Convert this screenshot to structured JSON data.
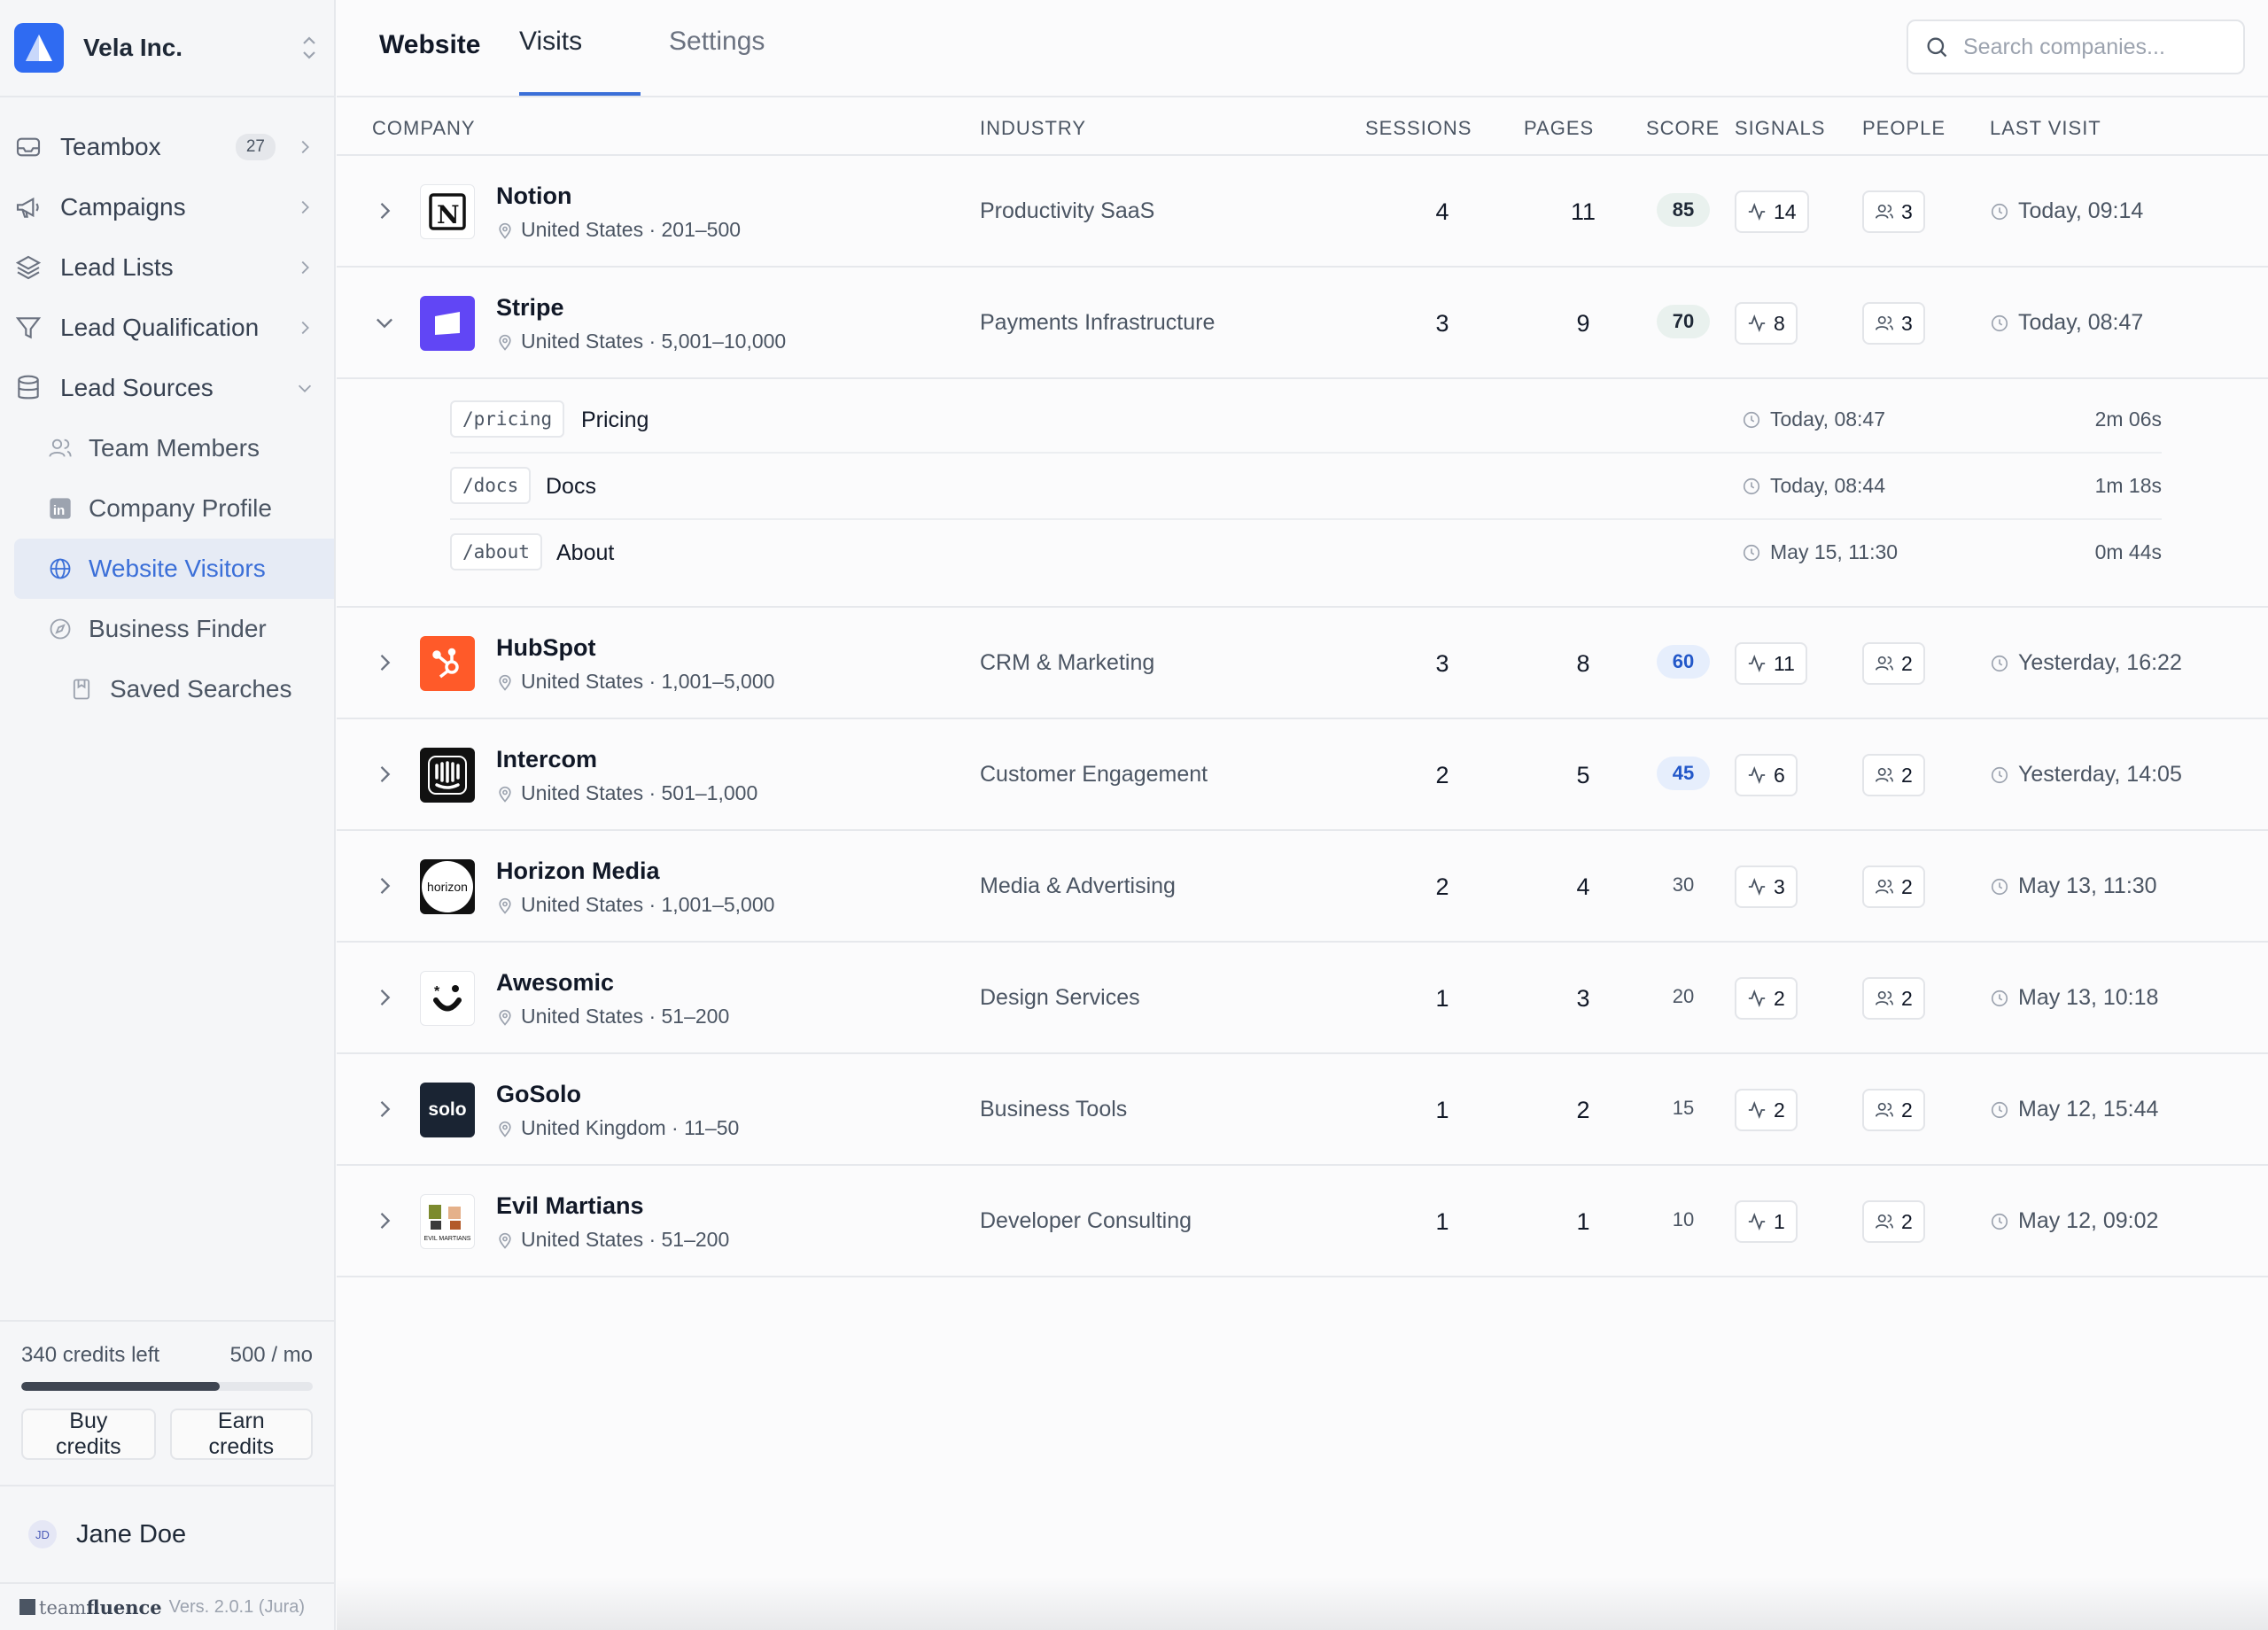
{
  "workspace": {
    "name": "Vela Inc."
  },
  "sidebar": {
    "items": [
      {
        "label": "Teambox",
        "badge": "27",
        "icon": "inbox-icon"
      },
      {
        "label": "Campaigns",
        "icon": "megaphone-icon"
      },
      {
        "label": "Lead Lists",
        "icon": "layers-icon"
      },
      {
        "label": "Lead Qualification",
        "icon": "filter-icon"
      },
      {
        "label": "Lead Sources",
        "icon": "database-icon"
      }
    ],
    "sub_items": [
      {
        "label": "Team Members",
        "icon": "users-icon"
      },
      {
        "label": "Company Profile",
        "icon": "linkedin-icon"
      },
      {
        "label": "Website Visitors",
        "icon": "globe-icon",
        "active": true
      },
      {
        "label": "Business Finder",
        "icon": "compass-icon"
      },
      {
        "label": "Saved Searches",
        "icon": "bookmark-icon"
      }
    ]
  },
  "credits": {
    "left_label": "340 credits left",
    "plan_label": "500 / mo",
    "used_fraction": 0.68,
    "buy_label": "Buy credits",
    "earn_label": "Earn credits"
  },
  "user": {
    "initials": "JD",
    "name": "Jane Doe"
  },
  "footer": {
    "brand_light": "team",
    "brand_bold": "fluence",
    "version": "Vers. 2.0.1 (Jura)"
  },
  "tabs": {
    "website": "Website",
    "visits": "Visits",
    "settings": "Settings",
    "active": "Visits"
  },
  "search": {
    "placeholder": "Search companies..."
  },
  "columns": {
    "company": "COMPANY",
    "industry": "INDUSTRY",
    "sessions": "SESSIONS",
    "pages": "PAGES",
    "score": "SCORE",
    "signals": "SIGNALS",
    "people": "PEOPLE",
    "last_visit": "LAST VISIT"
  },
  "companies": [
    {
      "name": "Notion",
      "meta": "United States · 201–500",
      "industry": "Productivity SaaS",
      "sessions": "4",
      "pages": "11",
      "score": "85",
      "signals": "14",
      "people": "3",
      "last_visit": "Today, 09:14"
    },
    {
      "name": "Stripe",
      "meta": "United States · 5,001–10,000",
      "industry": "Payments Infrastructure",
      "sessions": "3",
      "pages": "9",
      "score": "70",
      "signals": "8",
      "people": "3",
      "last_visit": "Today, 08:47",
      "visits": [
        {
          "path": "/pricing",
          "title": "Pricing",
          "time": "Today, 08:47",
          "duration": "2m 06s"
        },
        {
          "path": "/docs",
          "title": "Docs",
          "time": "Today, 08:44",
          "duration": "1m 18s"
        },
        {
          "path": "/about",
          "title": "About",
          "time": "May 15, 11:30",
          "duration": "0m 44s"
        }
      ]
    },
    {
      "name": "HubSpot",
      "meta": "United States · 1,001–5,000",
      "industry": "CRM & Marketing",
      "sessions": "3",
      "pages": "8",
      "score": "60",
      "signals": "11",
      "people": "2",
      "last_visit": "Yesterday, 16:22"
    },
    {
      "name": "Intercom",
      "meta": "United States · 501–1,000",
      "industry": "Customer Engagement",
      "sessions": "2",
      "pages": "5",
      "score": "45",
      "signals": "6",
      "people": "2",
      "last_visit": "Yesterday, 14:05"
    },
    {
      "name": "Horizon Media",
      "meta": "United States · 1,001–5,000",
      "industry": "Media & Advertising",
      "sessions": "2",
      "pages": "4",
      "score": "30",
      "signals": "3",
      "people": "2",
      "last_visit": "May 13, 11:30",
      "logo_text": "horizon"
    },
    {
      "name": "Awesomic",
      "meta": "United States · 51–200",
      "industry": "Design Services",
      "sessions": "1",
      "pages": "3",
      "score": "20",
      "signals": "2",
      "people": "2",
      "last_visit": "May 13, 10:18"
    },
    {
      "name": "GoSolo",
      "meta": "United Kingdom · 11–50",
      "industry": "Business Tools",
      "sessions": "1",
      "pages": "2",
      "score": "15",
      "signals": "2",
      "people": "2",
      "last_visit": "May 12, 15:44",
      "logo_text": "solo"
    },
    {
      "name": "Evil Martians",
      "meta": "United States · 51–200",
      "industry": "Developer Consulting",
      "sessions": "1",
      "pages": "1",
      "score": "10",
      "signals": "1",
      "people": "2",
      "last_visit": "May 12, 09:02",
      "logo_text": "EVIL MARTIANS"
    }
  ]
}
